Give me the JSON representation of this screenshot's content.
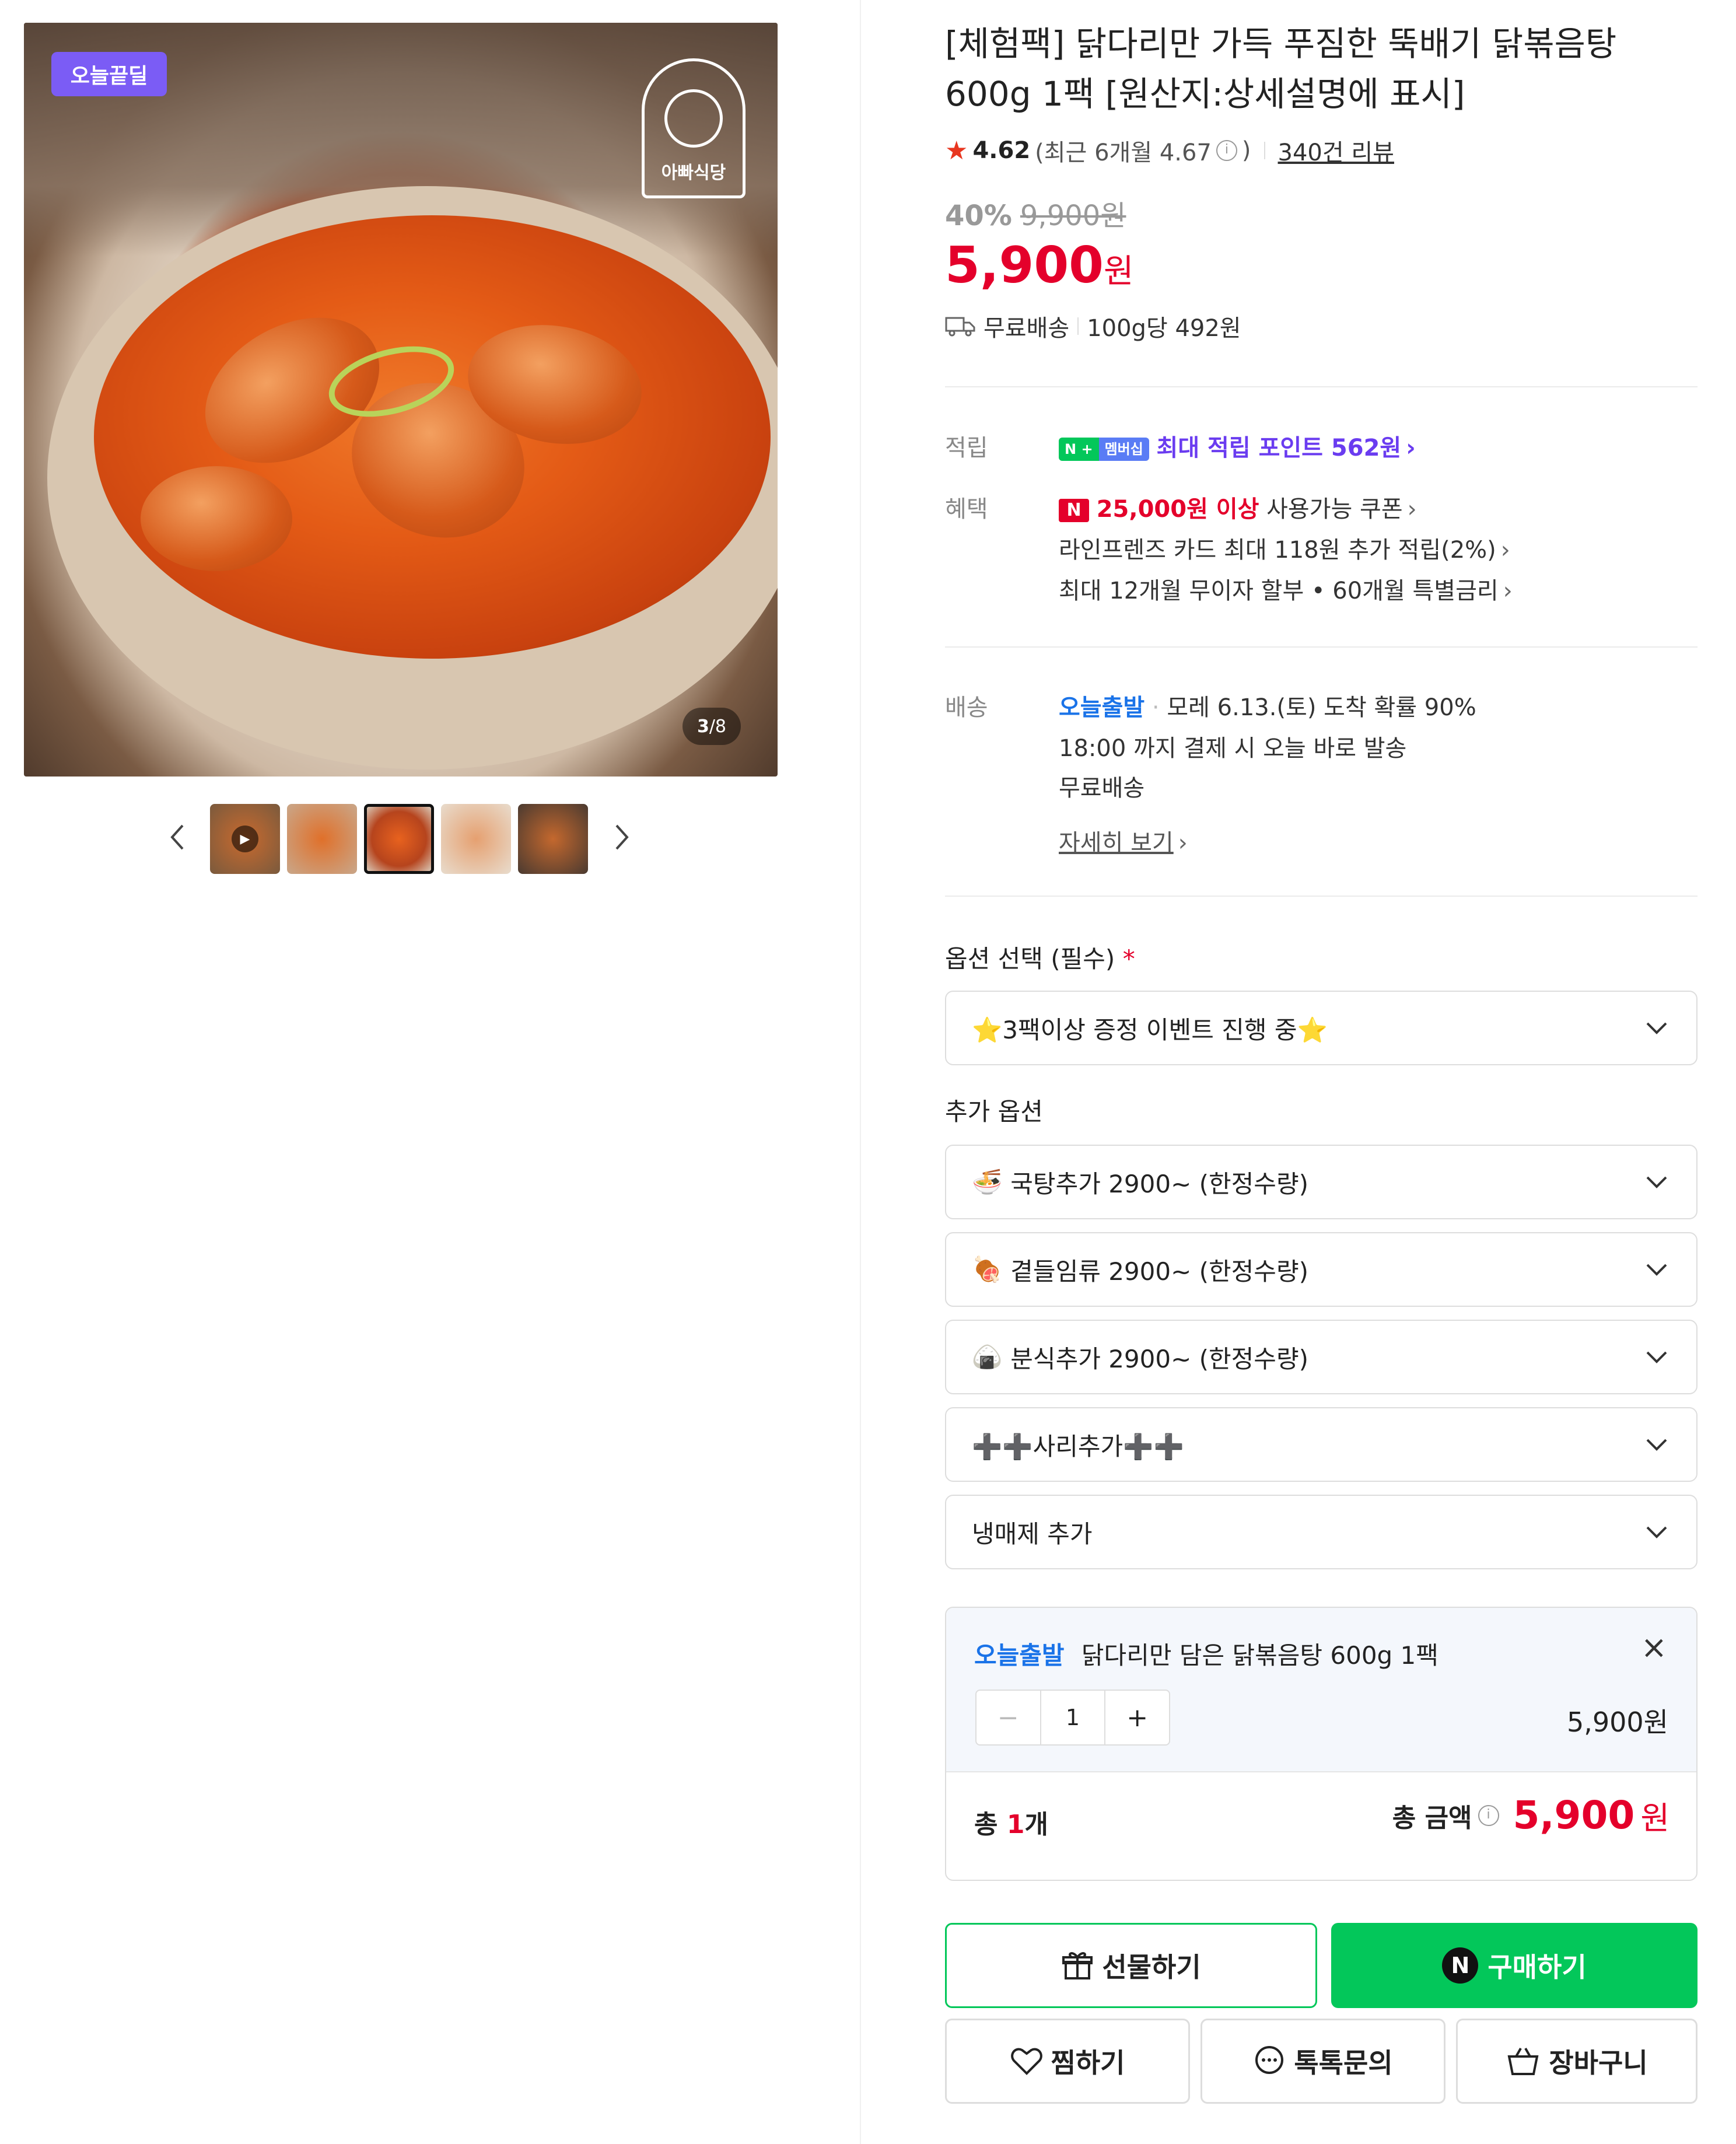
{
  "gallery": {
    "deal_badge": "오늘끝딜",
    "logo_text": "아빠식당",
    "counter_current": "3",
    "counter_total": "/8",
    "selected_index": 3,
    "thumb_count": 5
  },
  "product": {
    "title": "[체험팩] 닭다리만 가득 푸짐한 뚝배기 닭볶음탕 600g 1팩 [원산지:상세설명에 표시]",
    "rating": "4.62",
    "recent_label": "(최근 6개월 4.67",
    "recent_close": ")",
    "reviews": "340건 리뷰",
    "discount_pct": "40%",
    "original_price": "9,900원",
    "price": "5,900",
    "price_unit": "원",
    "shipping": "무료배송",
    "unit_price": "100g당 492원"
  },
  "benefits": {
    "points_label": "적립",
    "npay_n": "N +",
    "npay_member": "멤버십",
    "points_text": "최대 적립 포인트 562원",
    "benefit_label": "혜택",
    "coupon_n": "N",
    "coupon_bold": "25,000원 이상",
    "coupon_rest": "사용가능 쿠폰",
    "card_text": "라인프렌즈 카드 최대 118원 추가 적립(2%)",
    "installment_text": "최대 12개월 무이자 할부 • 60개월 특별금리"
  },
  "delivery": {
    "label": "배송",
    "badge": "오늘출발",
    "eta": "모레 6.13.(토) 도착 확률 90%",
    "cutoff": "18:00 까지 결제 시 오늘 바로 발송",
    "fee": "무료배송",
    "more_link": "자세히 보기"
  },
  "options": {
    "required_label": "옵션 선택 (필수)",
    "required_star": "*",
    "required_value": "⭐3팩이상 증정 이벤트 진행 중⭐",
    "extra_label": "추가 옵션",
    "extras": [
      {
        "icon": "🍜",
        "label": "국탕추가 2900~ (한정수량)"
      },
      {
        "icon": "🍖",
        "label": "곁들임류 2900~ (한정수량)"
      },
      {
        "icon": "🍙",
        "label": "분식추가 2900~ (한정수량)"
      },
      {
        "icon": "",
        "label": "➕➕사리추가➕➕"
      },
      {
        "icon": "",
        "label": "냉매제 추가"
      }
    ]
  },
  "cart_item": {
    "badge": "오늘출발",
    "name": "닭다리만 담은 닭볶음탕 600g 1팩",
    "close": "×",
    "minus": "−",
    "qty": "1",
    "plus": "+",
    "price": "5,900원"
  },
  "total": {
    "count_prefix": "총 ",
    "count_num": "1",
    "count_suffix": "개",
    "amount_label": "총 금액",
    "amount": "5,900",
    "amount_unit": "원"
  },
  "actions": {
    "gift": "선물하기",
    "buy_n": "N",
    "buy": "구매하기",
    "wish": "찜하기",
    "talk": "톡톡문의",
    "cart": "장바구니"
  },
  "colors": {
    "price_red": "#e4002b",
    "npay_green": "#03c75a",
    "deal_purple": "#7b5cf5",
    "today_blue": "#1a73e8"
  }
}
